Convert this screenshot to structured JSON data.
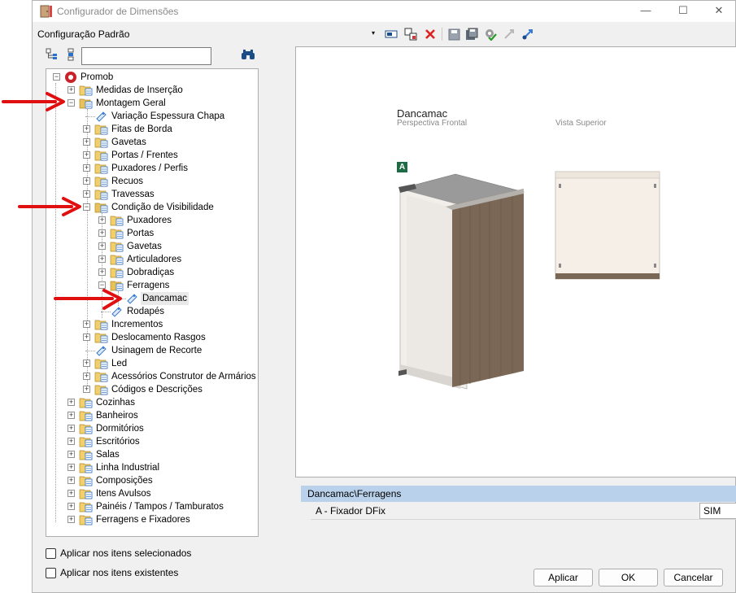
{
  "window": {
    "title": "Configurador de Dimensões",
    "controls": {
      "minimize": "—",
      "maximize": "☐",
      "close": "✕"
    }
  },
  "toolbar": {
    "config_label": "Configuração Padrão",
    "dropdown_arrow": "▾"
  },
  "search": {
    "placeholder": "",
    "value": ""
  },
  "tree": {
    "root": "Promob",
    "items": [
      {
        "label": "Medidas de Inserção"
      },
      {
        "label": "Montagem Geral"
      },
      {
        "label": "Variação Espessura Chapa"
      },
      {
        "label": "Fitas de Borda"
      },
      {
        "label": "Gavetas"
      },
      {
        "label": "Portas / Frentes"
      },
      {
        "label": "Puxadores / Perfis"
      },
      {
        "label": "Recuos"
      },
      {
        "label": "Travessas"
      },
      {
        "label": "Condição de Visibilidade"
      },
      {
        "label": "Puxadores"
      },
      {
        "label": "Portas"
      },
      {
        "label": "Gavetas"
      },
      {
        "label": "Articuladores"
      },
      {
        "label": "Dobradiças"
      },
      {
        "label": "Ferragens"
      },
      {
        "label": "Dancamac"
      },
      {
        "label": "Rodapés"
      },
      {
        "label": "Incrementos"
      },
      {
        "label": "Deslocamento Rasgos"
      },
      {
        "label": "Usinagem de Recorte"
      },
      {
        "label": "Led"
      },
      {
        "label": "Acessórios Construtor de Armários"
      },
      {
        "label": "Códigos e Descrições"
      },
      {
        "label": "Cozinhas"
      },
      {
        "label": "Banheiros"
      },
      {
        "label": "Dormitórios"
      },
      {
        "label": "Escritórios"
      },
      {
        "label": "Salas"
      },
      {
        "label": "Linha Industrial"
      },
      {
        "label": "Composições"
      },
      {
        "label": "Itens Avulsos"
      },
      {
        "label": "Painéis / Tampos / Tamburatos"
      },
      {
        "label": "Ferragens e Fixadores"
      }
    ]
  },
  "preview": {
    "title": "Dancamac",
    "front_label": "Perspectiva Frontal",
    "top_label": "Vista Superior",
    "badge": "A",
    "colors": {
      "wood": "#7a6756",
      "badge": "#1e6b46"
    }
  },
  "properties": {
    "group": "Dancamac\\Ferragens",
    "rows": [
      {
        "name": "A - Fixador DFix",
        "value": "SIM"
      }
    ]
  },
  "options": {
    "apply_selected": "Aplicar nos itens selecionados",
    "apply_existing": "Aplicar nos itens existentes"
  },
  "buttons": {
    "apply": "Aplicar",
    "ok": "OK",
    "cancel": "Cancelar"
  }
}
